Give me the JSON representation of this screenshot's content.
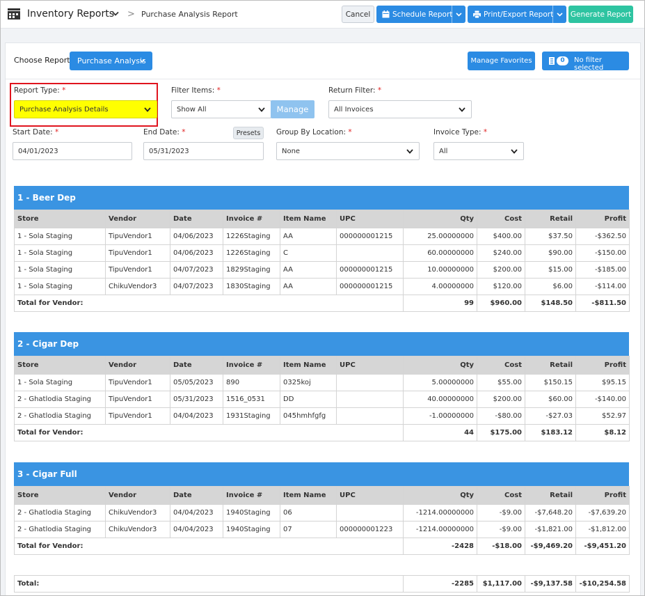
{
  "header": {
    "app_title": "Inventory Reports",
    "breadcrumb_sep": ">",
    "breadcrumb_page": "Purchase Analysis Report",
    "cancel_label": "Cancel",
    "schedule_label": "Schedule Report",
    "print_label": "Print/Export Report",
    "generate_label": "Generate Report"
  },
  "toolbar": {
    "choose_label": "Choose Report",
    "choose_value": "Purchase Analysis",
    "favorites_label": "Manage Favorites",
    "filter_count": "0",
    "filter_label": "No filter selected"
  },
  "form": {
    "report_type_label": "Report Type:",
    "report_type_value": "Purchase Analysis Details",
    "filter_items_label": "Filter Items:",
    "filter_items_value": "Show All",
    "manage_label": "Manage",
    "return_filter_label": "Return Filter:",
    "return_filter_value": "All Invoices",
    "start_date_label": "Start Date:",
    "start_date_value": "04/01/2023",
    "end_date_label": "End Date:",
    "end_date_value": "05/31/2023",
    "presets_label": "Presets",
    "group_by_label": "Group By Location:",
    "group_by_value": "None",
    "invoice_type_label": "Invoice Type:",
    "invoice_type_value": "All",
    "required_mark": "*"
  },
  "columns": [
    "Store",
    "Vendor",
    "Date",
    "Invoice #",
    "Item Name",
    "UPC",
    "Qty",
    "Cost",
    "Retail",
    "Profit"
  ],
  "total_vendor_label": "Total for Vendor:",
  "groups": [
    {
      "title": "1 - Beer Dep",
      "rows": [
        [
          "1 - Sola Staging",
          "TipuVendor1",
          "04/06/2023",
          "1226Staging",
          "AA",
          "000000001215",
          "25.00000000",
          "$400.00",
          "$37.50",
          "-$362.50"
        ],
        [
          "1 - Sola Staging",
          "TipuVendor1",
          "04/06/2023",
          "1226Staging",
          "C",
          "",
          "60.00000000",
          "$240.00",
          "$90.00",
          "-$150.00"
        ],
        [
          "1 - Sola Staging",
          "TipuVendor1",
          "04/07/2023",
          "1829Staging",
          "AA",
          "000000001215",
          "10.00000000",
          "$200.00",
          "$15.00",
          "-$185.00"
        ],
        [
          "1 - Sola Staging",
          "ChikuVendor3",
          "04/07/2023",
          "1830Staging",
          "AA",
          "000000001215",
          "4.00000000",
          "$120.00",
          "$6.00",
          "-$114.00"
        ]
      ],
      "total": {
        "qty": "99",
        "cost": "$960.00",
        "retail": "$148.50",
        "profit": "-$811.50"
      }
    },
    {
      "title": "2 - Cigar Dep",
      "rows": [
        [
          "1 - Sola Staging",
          "TipuVendor1",
          "05/05/2023",
          "890",
          "0325koj",
          "",
          "5.00000000",
          "$55.00",
          "$150.15",
          "$95.15"
        ],
        [
          "2 - Ghatlodia Staging",
          "TipuVendor1",
          "05/31/2023",
          "1516_0531",
          "DD",
          "",
          "40.00000000",
          "$200.00",
          "$60.00",
          "-$140.00"
        ],
        [
          "2 - Ghatlodia Staging",
          "TipuVendor1",
          "04/04/2023",
          "1931Staging",
          "045hmhfgfg",
          "",
          "-1.00000000",
          "-$80.00",
          "-$27.03",
          "$52.97"
        ]
      ],
      "total": {
        "qty": "44",
        "cost": "$175.00",
        "retail": "$183.12",
        "profit": "$8.12"
      }
    },
    {
      "title": "3 - Cigar Full",
      "rows": [
        [
          "2 - Ghatlodia Staging",
          "ChikuVendor3",
          "04/04/2023",
          "1940Staging",
          "06",
          "",
          "-1214.00000000",
          "-$9.00",
          "-$7,648.20",
          "-$7,639.20"
        ],
        [
          "2 - Ghatlodia Staging",
          "ChikuVendor3",
          "04/04/2023",
          "1940Staging",
          "07",
          "000000001223",
          "-1214.00000000",
          "-$9.00",
          "-$1,821.00",
          "-$1,812.00"
        ]
      ],
      "total": {
        "qty": "-2428",
        "cost": "-$18.00",
        "retail": "-$9,469.20",
        "profit": "-$9,451.20"
      }
    }
  ],
  "grand_total": {
    "label": "Total:",
    "qty": "-2285",
    "cost": "$1,117.00",
    "retail": "-$9,137.58",
    "profit": "-$10,254.58"
  },
  "colors": {
    "accent": "#2b8be3",
    "generate": "#2ec4a1",
    "group_header": "#3a94e2",
    "highlight": "#ffff00",
    "highlight_border": "#e0141e"
  }
}
